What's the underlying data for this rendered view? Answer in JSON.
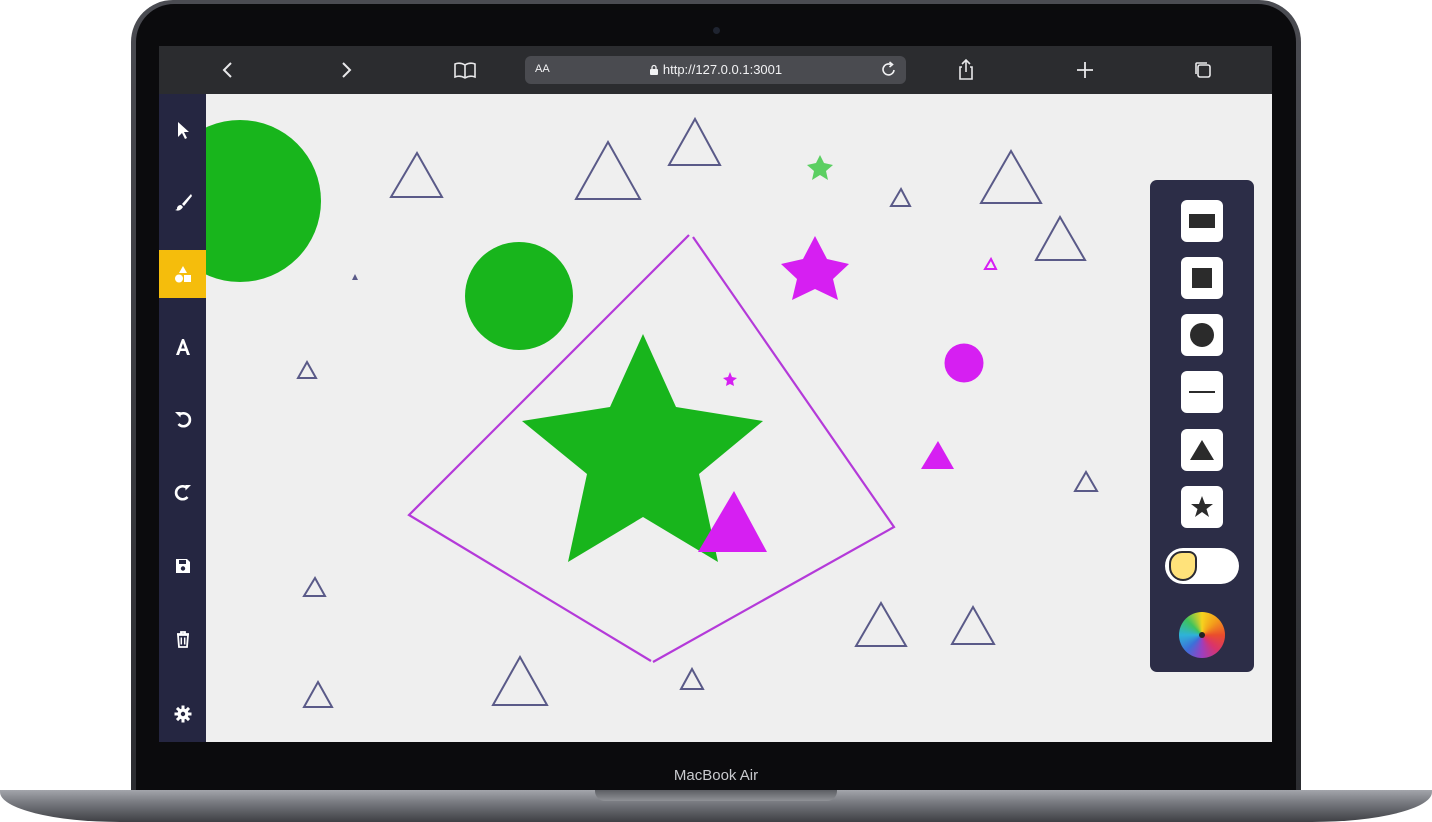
{
  "browser": {
    "back_icon": "chevron-left-icon",
    "forward_icon": "chevron-right-icon",
    "reader_icon": "book-icon",
    "text_size_label": "AA",
    "url": "http://127.0.0.1:3001",
    "share_icon": "share-icon",
    "new_tab_icon": "plus-icon",
    "tabs_icon": "tabs-icon"
  },
  "laptop": {
    "brand": "MacBook Air"
  },
  "left_toolbar": {
    "items": [
      {
        "name": "select",
        "icon": "cursor-icon",
        "active": false
      },
      {
        "name": "brush",
        "icon": "brush-icon",
        "active": false
      },
      {
        "name": "shapes",
        "icon": "shapes-icon",
        "active": true
      },
      {
        "name": "text",
        "icon": "text-icon",
        "active": false
      },
      {
        "name": "undo",
        "icon": "undo-icon",
        "active": false
      },
      {
        "name": "redo",
        "icon": "redo-icon",
        "active": false
      },
      {
        "name": "save",
        "icon": "save-icon",
        "active": false
      },
      {
        "name": "delete",
        "icon": "trash-icon",
        "active": false
      },
      {
        "name": "settings",
        "icon": "gear-icon",
        "active": false
      }
    ],
    "active_color": "#f5bd0c"
  },
  "shape_palette": {
    "items": [
      "rectangle-icon",
      "square-icon",
      "circle-icon",
      "line-icon",
      "triangle-icon",
      "star-icon"
    ],
    "fill_toggle": "fill-toggle",
    "color_picker": "color-wheel-icon"
  },
  "colors": {
    "green": "#18b51c",
    "light_green": "#5bcf62",
    "magenta": "#d61ff2",
    "outline": "#5a5a88",
    "canvas_bg": "#efefef",
    "toolbar_bg": "#252641"
  }
}
